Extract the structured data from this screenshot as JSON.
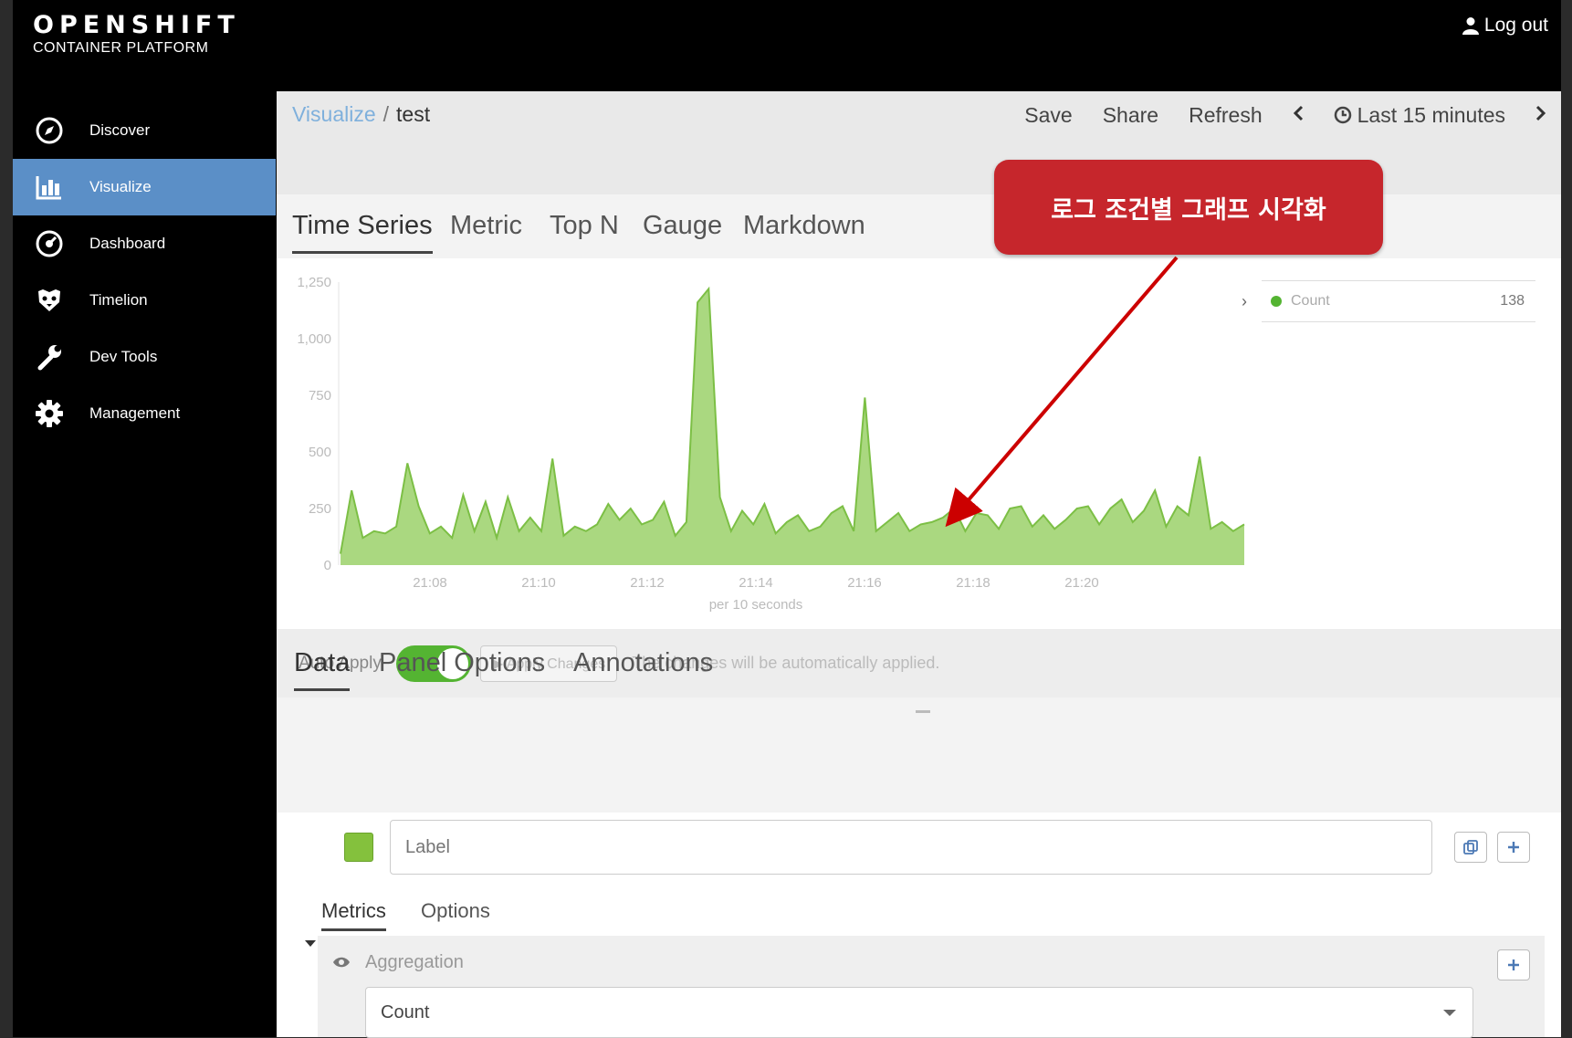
{
  "brand": {
    "title": "OPENSHIFT",
    "subtitle": "CONTAINER PLATFORM"
  },
  "header": {
    "logout_label": "Log out"
  },
  "sidebar": {
    "items": [
      {
        "label": "Discover",
        "icon": "compass-icon"
      },
      {
        "label": "Visualize",
        "icon": "bar-chart-icon",
        "active": true
      },
      {
        "label": "Dashboard",
        "icon": "dashboard-icon"
      },
      {
        "label": "Timelion",
        "icon": "timelion-icon"
      },
      {
        "label": "Dev Tools",
        "icon": "wrench-icon"
      },
      {
        "label": "Management",
        "icon": "gear-icon"
      }
    ]
  },
  "breadcrumb": {
    "parent": "Visualize",
    "separator": "/",
    "current": "test"
  },
  "toolbar": {
    "save": "Save",
    "share": "Share",
    "refresh": "Refresh",
    "time_range": "Last 15 minutes"
  },
  "viz_tabs": [
    "Time Series",
    "Metric",
    "Top N",
    "Gauge",
    "Markdown"
  ],
  "annotation_callout": "로그 조건별 그래프 시각화",
  "legend": {
    "name": "Count",
    "value": "138"
  },
  "chart_data": {
    "type": "area",
    "xlabel": "per 10 seconds",
    "x_ticks": [
      "21:08",
      "21:10",
      "21:12",
      "21:14",
      "21:16",
      "21:18",
      "21:20"
    ],
    "y_ticks": [
      "0",
      "250",
      "500",
      "750",
      "1,000",
      "1,250"
    ],
    "ylim": [
      0,
      1250
    ],
    "color": "#9bd16a",
    "series": [
      {
        "name": "Count",
        "values": [
          50,
          330,
          120,
          150,
          140,
          170,
          450,
          260,
          140,
          170,
          120,
          310,
          150,
          280,
          120,
          300,
          150,
          210,
          150,
          470,
          130,
          170,
          150,
          180,
          270,
          200,
          250,
          180,
          200,
          280,
          130,
          190,
          1160,
          1220,
          300,
          150,
          240,
          180,
          270,
          140,
          190,
          220,
          150,
          170,
          230,
          260,
          150,
          740,
          150,
          190,
          230,
          150,
          180,
          190,
          210,
          250,
          150,
          230,
          220,
          160,
          250,
          260,
          170,
          220,
          160,
          200,
          250,
          260,
          180,
          250,
          290,
          190,
          240,
          330,
          170,
          260,
          220,
          480,
          160,
          190,
          150,
          180
        ]
      }
    ]
  },
  "apply_bar": {
    "auto_apply_label": "Auto Apply",
    "apply_button": "▶ Apply Changes",
    "note": "The changes will be automatically applied."
  },
  "data_tabs": [
    "Data",
    "Panel Options",
    "Annotations"
  ],
  "series_editor": {
    "label_placeholder": "Label",
    "swatch_color": "#84c13d",
    "subtabs": [
      "Metrics",
      "Options"
    ],
    "aggregation_label": "Aggregation",
    "aggregation_value": "Count"
  }
}
